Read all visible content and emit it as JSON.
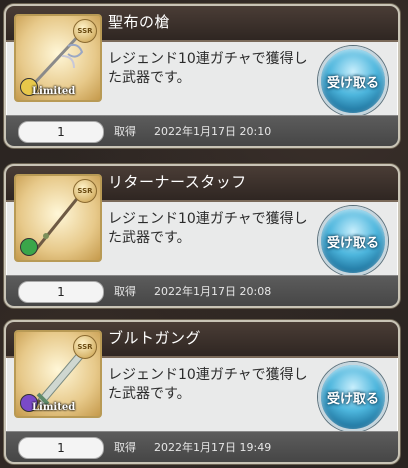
{
  "items": [
    {
      "name": "聖布の槍",
      "description": "レジェンド10連ガチャで獲得した武器です。",
      "quantity": "1",
      "status": "取得",
      "date": "2022年1月17日 20:10",
      "rarity": "SSR",
      "limited": "Limited",
      "element_icon": "light-element-icon",
      "element_color": "#e8c84a",
      "receive_label": "受け取る"
    },
    {
      "name": "リターナースタッフ",
      "description": "レジェンド10連ガチャで獲得した武器です。",
      "quantity": "1",
      "status": "取得",
      "date": "2022年1月17日 20:08",
      "rarity": "SSR",
      "limited": "",
      "element_icon": "wind-element-icon",
      "element_color": "#3aa64a",
      "receive_label": "受け取る"
    },
    {
      "name": "ブルトガング",
      "description": "レジェンド10連ガチャで獲得した武器です。",
      "quantity": "1",
      "status": "取得",
      "date": "2022年1月17日 19:49",
      "rarity": "SSR",
      "limited": "Limited",
      "element_icon": "dark-element-icon",
      "element_color": "#7a4ac8",
      "receive_label": "受け取る"
    }
  ]
}
